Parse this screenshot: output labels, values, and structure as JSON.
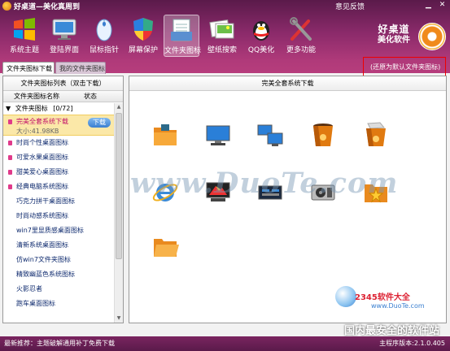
{
  "window": {
    "title": "好桌道—美化真周到",
    "feedback": "意见反馈",
    "minimize": "▁",
    "close": "✕"
  },
  "toolbar": {
    "items": [
      {
        "label": "系统主题",
        "icon": "windows-logo-icon"
      },
      {
        "label": "登陆界面",
        "icon": "monitor-icon"
      },
      {
        "label": "鼠标指针",
        "icon": "mouse-icon"
      },
      {
        "label": "屏幕保护",
        "icon": "shield-icon"
      },
      {
        "label": "文件夹图标",
        "icon": "folder-document-icon"
      },
      {
        "label": "壁纸搜索",
        "icon": "wallpaper-icon"
      },
      {
        "label": "QQ美化",
        "icon": "qq-penguin-icon"
      },
      {
        "label": "更多功能",
        "icon": "tools-icon"
      }
    ],
    "active_index": 4
  },
  "brand": {
    "line1": "好桌道",
    "line2": "美化软件"
  },
  "tabs": [
    {
      "label": "文件夹图标下载",
      "active": true
    },
    {
      "label": "我的文件夹图标",
      "active": false
    }
  ],
  "restore_link": "(还原为默认文件夹图标)",
  "left_panel": {
    "title": "文件夹图标列表（双击下载）",
    "col_name": "文件夹图标名称",
    "col_status": "状态",
    "group_label": "文件夹图标",
    "group_count": "[0/72]",
    "selected": {
      "name": "完美全套系统下载",
      "size": "大小:41.98KB",
      "button": "下载"
    },
    "items": [
      "时尚个性桌面图标",
      "可爱水果桌面图标",
      "甜美爱心桌面图标",
      "经典电脑系统图标",
      "巧克力拼干桌面图标",
      "时尚动感系统图标",
      "win7里显质感桌面图标",
      "清新系统桌面图标",
      "仿win7文件夹图标",
      "精致幽蓝色系统图标",
      "火影忍者",
      "跑车桌面图标"
    ]
  },
  "right_panel": {
    "title": "完美全套系统下载",
    "icons": [
      "folder-orange-icon",
      "monitor-blue-icon",
      "network-computers-icon",
      "recycle-bin-empty-icon",
      "recycle-bin-full-icon",
      "internet-explorer-icon",
      "display-settings-icon",
      "network-connection-icon",
      "hard-drive-icon",
      "favorites-star-icon",
      "folder-open-icon"
    ]
  },
  "watermark": {
    "main": "www.DuoTe.com",
    "site": "2345软件大全",
    "site_url": "www.DuoTe.com",
    "tagline": "国内最安全的软件站"
  },
  "status": {
    "news": "最新推荐：主题破解通用补丁免费下载",
    "version": "主程序版本:2.1.0.405"
  }
}
